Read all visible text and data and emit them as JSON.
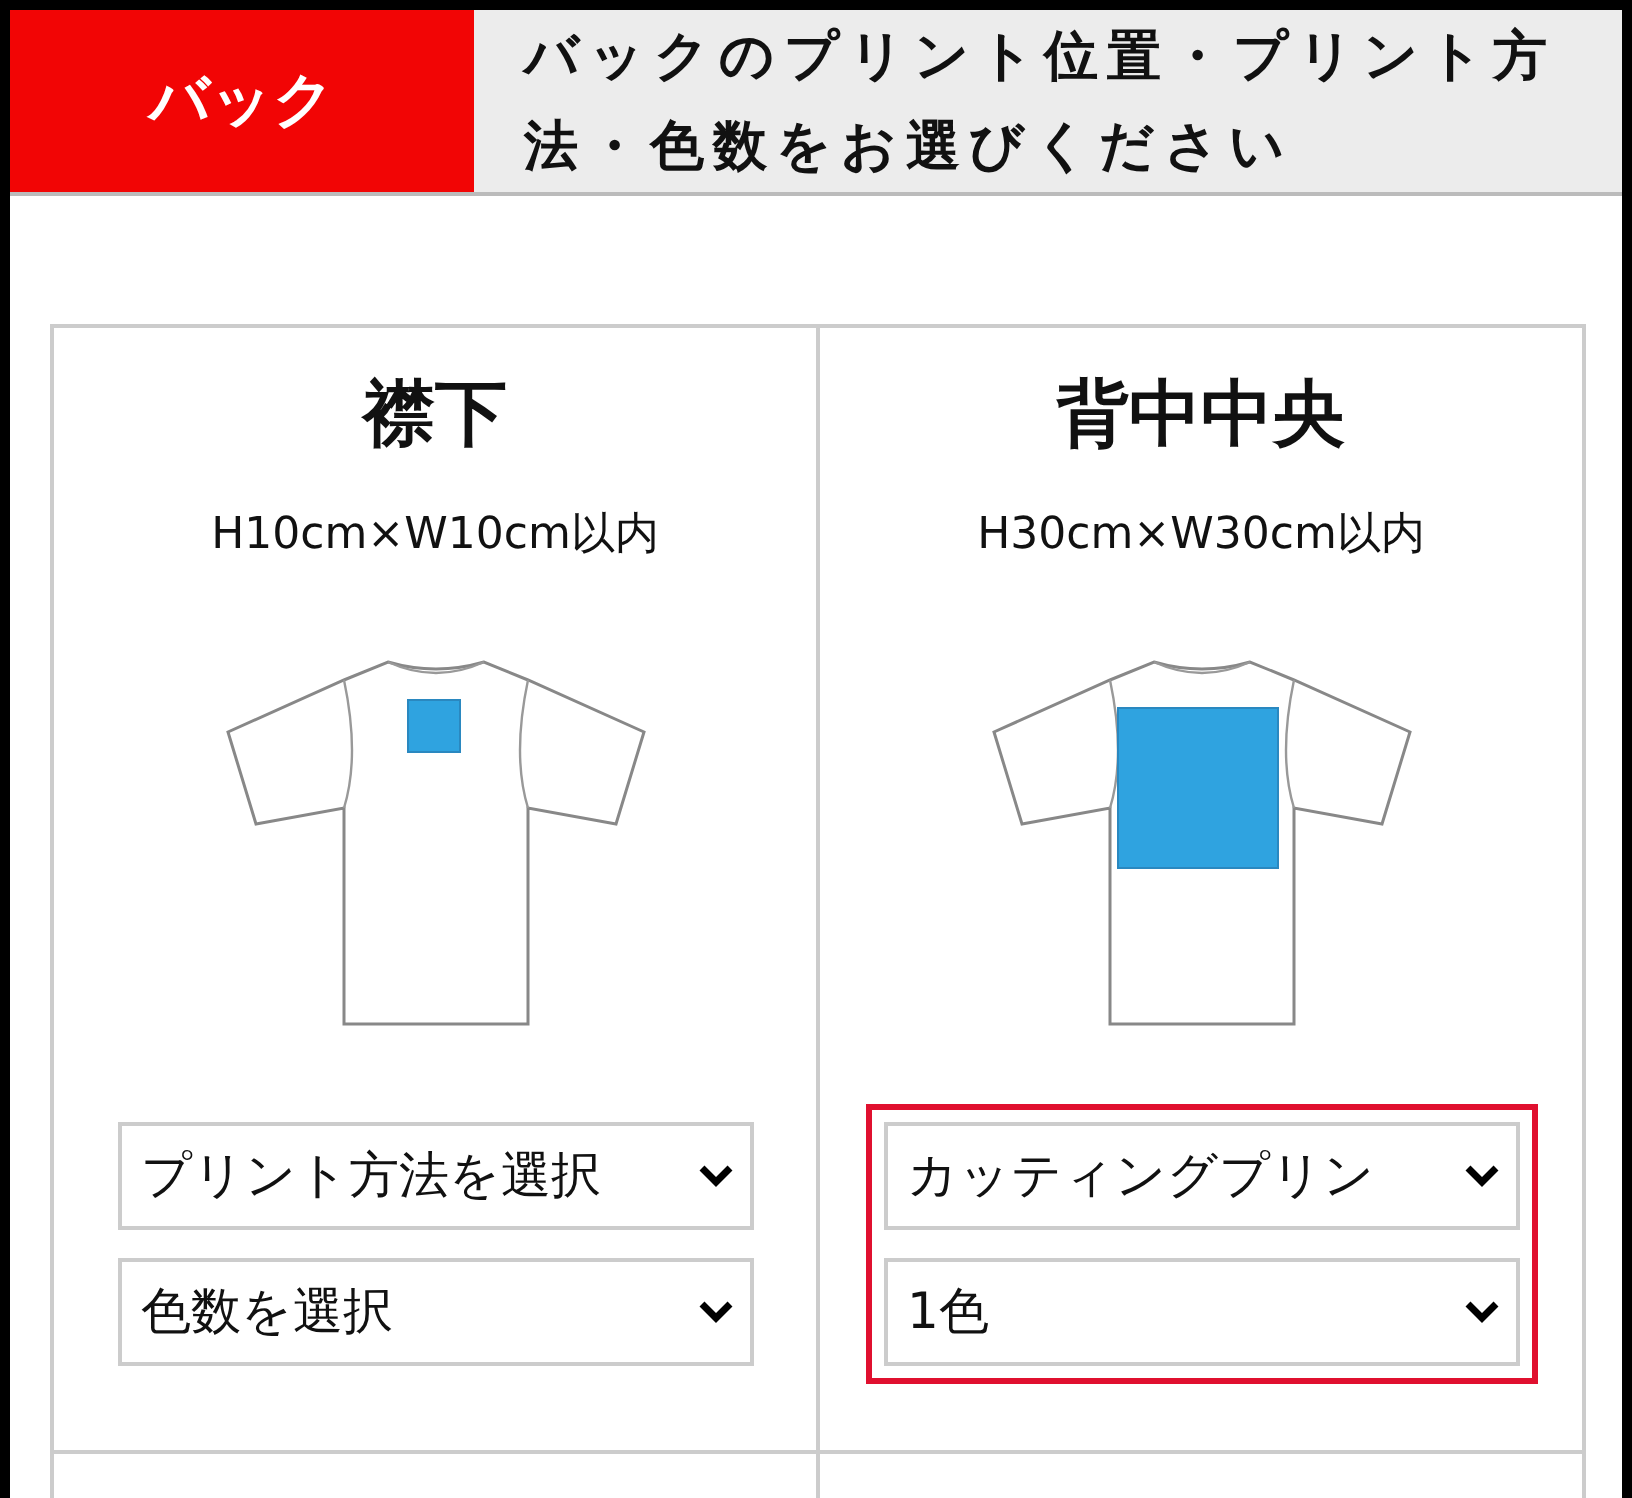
{
  "header": {
    "tag": "バック",
    "instruction": "バックのプリント位置・プリント方法・色数をお選びください"
  },
  "positions": [
    {
      "title": "襟下",
      "size": "H10cm×W10cm以内",
      "kind": "collar",
      "selected": false,
      "method": "プリント方法を選択",
      "colors": "色数を選択"
    },
    {
      "title": "背中中央",
      "size": "H30cm×W30cm以内",
      "kind": "center",
      "selected": true,
      "method": "カッティングプリン",
      "colors": "1色"
    }
  ]
}
